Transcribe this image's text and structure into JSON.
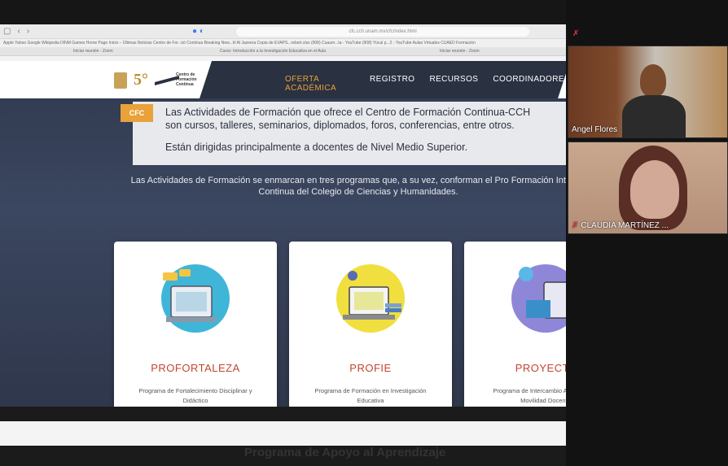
{
  "browser": {
    "url": "cfc.cch.unam.mx/cfc/index.html",
    "bookmarks": "Apple  Yahoo  Google  Wikipedia  DINM Games Home Page  Inicio – Últimas Noticias  Centro de For. ció Continua  Breaking New...hl Al Jazeera  Copia de EVAPS...rebert.xlsx  (908) Cuaum...ta - YouTube  (908) Yücul p...2 - YouTube  Aulas Virtuales CUAED  Formación",
    "tabs": [
      "Iniciar reunión - Zoom",
      "Curso: Introducción a la Investigación Educativa en el Aula",
      "Iniciar reunión - Zoom"
    ]
  },
  "site": {
    "nav": [
      "OFERTA ACADÉMICA",
      "REGISTRO",
      "RECURSOS",
      "COORDINADORES"
    ],
    "logo_text": "Centro de Formación Continua",
    "logo_five": "5°",
    "banner_tag": "CFC",
    "banner_line1": "Las Actividades de Formación que ofrece el Centro de Formación Continua-CCH",
    "banner_line2": "son cursos, talleres, seminarios, diplomados, foros, conferencias, entre otros.",
    "banner_line3": "Están dirigidas principalmente a docentes de Nivel Medio Superior.",
    "intro": "Las Actividades de Formación se enmarcan en tres programas que, a su vez, conforman el Pro Formación Integral Continua del Colegio de Ciencias y Humanidades.",
    "cards": [
      {
        "title": "PROFORTALEZA",
        "desc": "Programa de Fortalecimiento Disciplinar y Didáctico"
      },
      {
        "title": "PROFIE",
        "desc": "Programa de Formación en Investigación Educativa"
      },
      {
        "title": "PROYECTA",
        "desc": "Programa de Intercambio Académico y Movilidad Docente"
      }
    ],
    "bottom_heading": "Programa de Apoyo al Aprendizaje"
  },
  "zoom": {
    "participants": [
      {
        "name": "Angel Flores"
      },
      {
        "name": "CLAUDIA MARTÍNEZ ..."
      }
    ]
  },
  "colors": {
    "accent": "#e9a13a",
    "card_title": "#c2452f",
    "navy": "#2a3140"
  }
}
